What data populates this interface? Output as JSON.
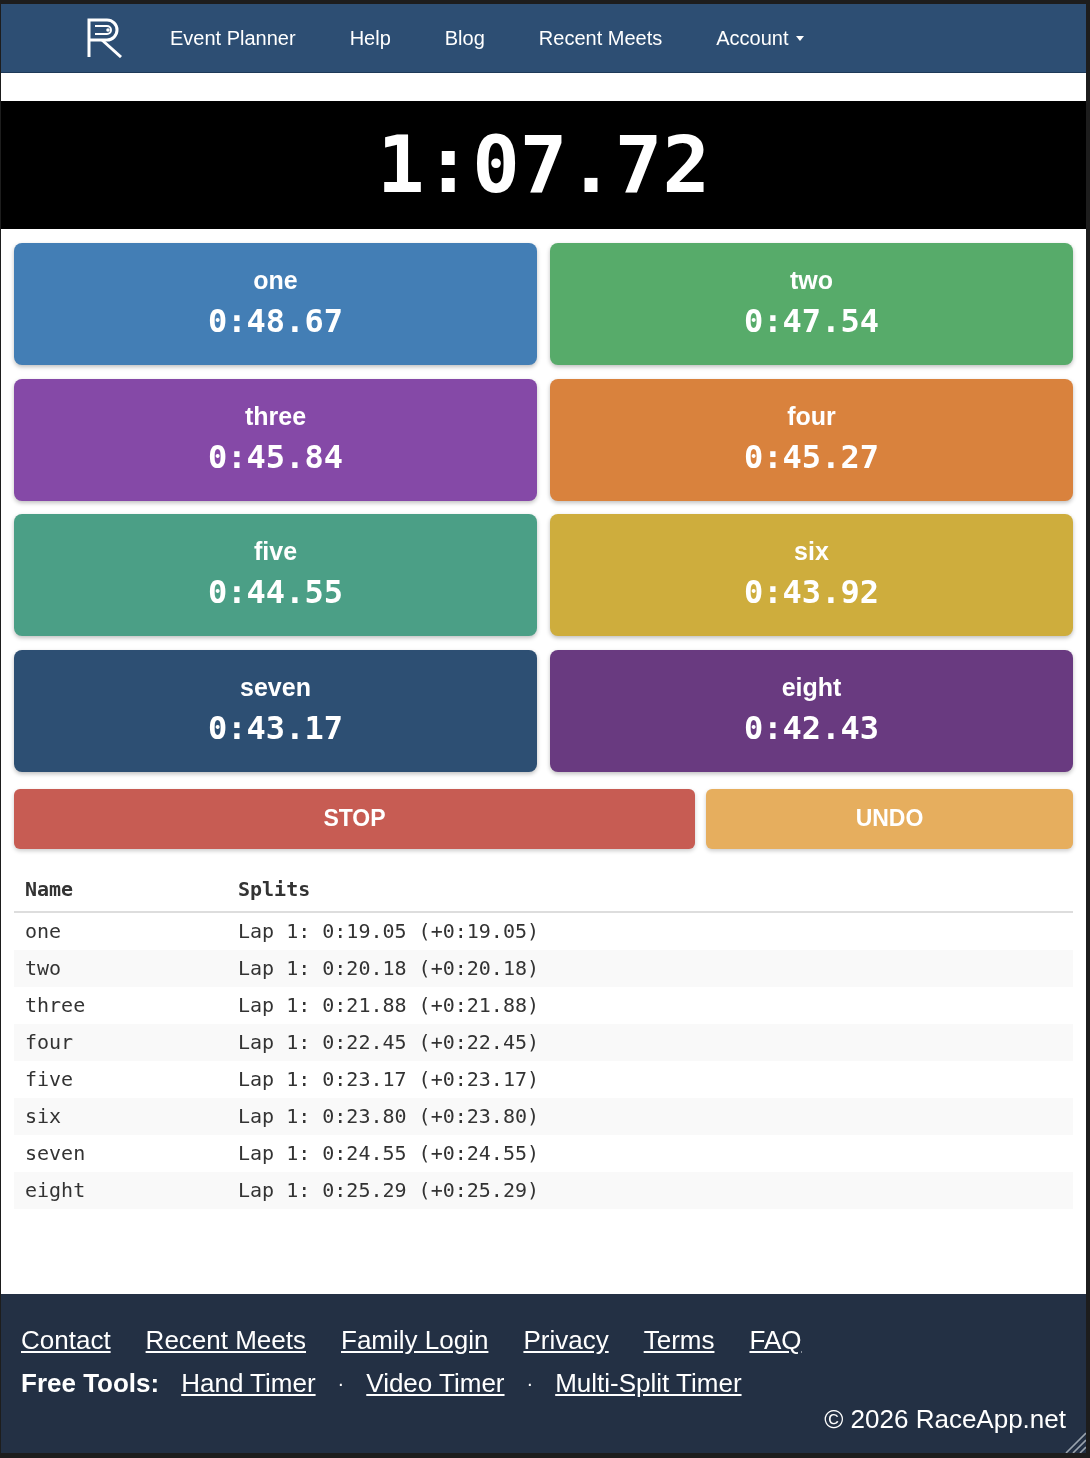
{
  "nav": {
    "items": [
      {
        "label": "Event Planner",
        "dropdown": false
      },
      {
        "label": "Help",
        "dropdown": false
      },
      {
        "label": "Blog",
        "dropdown": false
      },
      {
        "label": "Recent Meets",
        "dropdown": false
      },
      {
        "label": "Account",
        "dropdown": true
      }
    ]
  },
  "timer": {
    "time": "1:07.72"
  },
  "lanes": [
    {
      "name": "one",
      "time": "0:48.67",
      "color": "#437eb5"
    },
    {
      "name": "two",
      "time": "0:47.54",
      "color": "#57ab6a"
    },
    {
      "name": "three",
      "time": "0:45.84",
      "color": "#8549a7"
    },
    {
      "name": "four",
      "time": "0:45.27",
      "color": "#d9823d"
    },
    {
      "name": "five",
      "time": "0:44.55",
      "color": "#4b9f86"
    },
    {
      "name": "six",
      "time": "0:43.92",
      "color": "#cead3d"
    },
    {
      "name": "seven",
      "time": "0:43.17",
      "color": "#2d4f73"
    },
    {
      "name": "eight",
      "time": "0:42.43",
      "color": "#693a80"
    }
  ],
  "actions": [
    {
      "label": "STOP",
      "kind": "stop"
    },
    {
      "label": "UNDO",
      "kind": "undo"
    }
  ],
  "splits_table": {
    "columns": [
      "Name",
      "Splits"
    ],
    "rows": [
      {
        "name": "one",
        "splits": "Lap 1: 0:19.05 (+0:19.05)"
      },
      {
        "name": "two",
        "splits": "Lap 1: 0:20.18 (+0:20.18)"
      },
      {
        "name": "three",
        "splits": "Lap 1: 0:21.88 (+0:21.88)"
      },
      {
        "name": "four",
        "splits": "Lap 1: 0:22.45 (+0:22.45)"
      },
      {
        "name": "five",
        "splits": "Lap 1: 0:23.17 (+0:23.17)"
      },
      {
        "name": "six",
        "splits": "Lap 1: 0:23.80 (+0:23.80)"
      },
      {
        "name": "seven",
        "splits": "Lap 1: 0:24.55 (+0:24.55)"
      },
      {
        "name": "eight",
        "splits": "Lap 1: 0:25.29 (+0:25.29)"
      }
    ]
  },
  "footer": {
    "links": [
      "Contact",
      "Recent Meets",
      "Family Login",
      "Privacy",
      "Terms",
      "FAQ"
    ],
    "tools_row": [
      {
        "kind": "label",
        "text": "Free Tools:"
      },
      {
        "kind": "link",
        "text": "Hand Timer"
      },
      {
        "kind": "separator",
        "text": "·"
      },
      {
        "kind": "link",
        "text": "Video Timer"
      },
      {
        "kind": "separator",
        "text": "·"
      },
      {
        "kind": "link",
        "text": "Multi-Split Timer"
      }
    ],
    "copyright": "© 2026 RaceApp.net"
  }
}
